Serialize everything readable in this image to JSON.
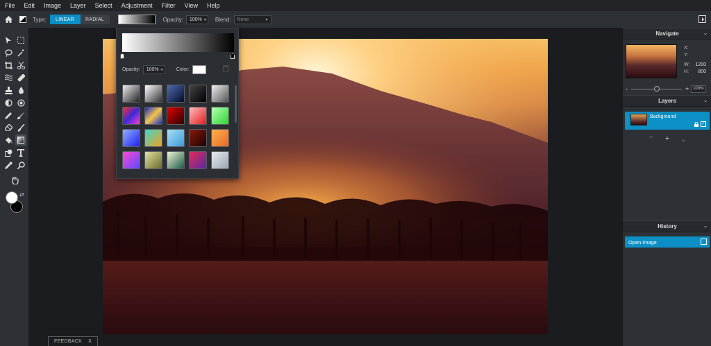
{
  "menu": [
    "File",
    "Edit",
    "Image",
    "Layer",
    "Select",
    "Adjustment",
    "Filter",
    "View",
    "Help"
  ],
  "options": {
    "type_label": "Type:",
    "type_linear": "LINEAR",
    "type_radial": "RADIAL",
    "opacity_label": "Opacity:",
    "opacity_value": "100%",
    "blend_label": "Blend:",
    "blend_value": "None"
  },
  "gradient_popup": {
    "opacity_label": "Opacity:",
    "opacity_value": "100%",
    "color_label": "Color:",
    "color_value": "#ffffff",
    "presets": [
      "linear-gradient(135deg,#eee,#222)",
      "linear-gradient(135deg,#fff,#333)",
      "linear-gradient(135deg,#4d6bb0,#050c2a)",
      "linear-gradient(135deg,#444,#000)",
      "linear-gradient(135deg,#eee,#555)",
      "linear-gradient(135deg,#ff2b2b,#3b2bd9 50%,#ff3bd0)",
      "linear-gradient(135deg,#1428c8,#f4c54a 50%,#1a2fd0)",
      "linear-gradient(135deg,#e00000,#2a0000)",
      "linear-gradient(135deg,#ffbdbd,#e01c1c)",
      "linear-gradient(135deg,#b8ffb8,#2ed42e)",
      "linear-gradient(135deg,#8fb0ff,#2020f0)",
      "linear-gradient(135deg,#3fd6c8,#f0a020)",
      "linear-gradient(135deg,#a8e0f0,#3a9adf)",
      "linear-gradient(135deg,#8a1a0a,#1a0303)",
      "linear-gradient(135deg,#ffb04a,#e86a2a)",
      "linear-gradient(135deg,#ff4ad0,#5a4aff)",
      "linear-gradient(135deg,#e0e2a0,#6a6a2a)",
      "linear-gradient(135deg,#f0f4d0,#1a5a4a)",
      "linear-gradient(135deg,#e02a5a,#5a2aa0)",
      "linear-gradient(135deg,#e8ecf0,#9aa4b0)"
    ]
  },
  "navigate": {
    "title": "Navigate",
    "x_label": "X:",
    "y_label": "Y:",
    "w_label": "W:",
    "w_value": "1200",
    "h_label": "H:",
    "h_value": "800",
    "zoom_value": "100%",
    "zoom_level": 0.5
  },
  "layers": {
    "title": "Layers",
    "items": [
      {
        "name": "Background"
      }
    ]
  },
  "history": {
    "title": "History",
    "items": [
      {
        "name": "Open image"
      }
    ]
  },
  "feedback": {
    "label": "FEEDBACK",
    "close": "X"
  },
  "colors": {
    "accent": "#0b8fc5",
    "foreground": "#ffffff",
    "background": "#000000"
  }
}
